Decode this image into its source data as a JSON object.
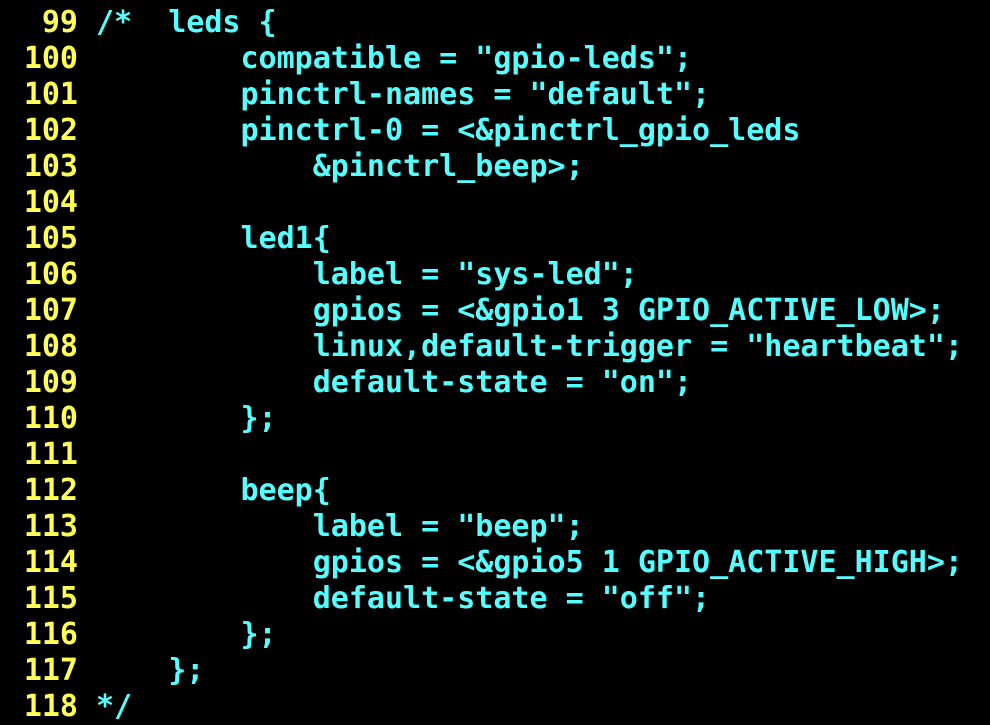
{
  "theme": {
    "background": "#000000",
    "line_number_color": "#ffff55",
    "code_color": "#55ffff"
  },
  "lines": [
    {
      "number": "99",
      "text": "/*  leds {"
    },
    {
      "number": "100",
      "text": "        compatible = \"gpio-leds\";"
    },
    {
      "number": "101",
      "text": "        pinctrl-names = \"default\";"
    },
    {
      "number": "102",
      "text": "        pinctrl-0 = <&pinctrl_gpio_leds"
    },
    {
      "number": "103",
      "text": "            &pinctrl_beep>;"
    },
    {
      "number": "104",
      "text": ""
    },
    {
      "number": "105",
      "text": "        led1{"
    },
    {
      "number": "106",
      "text": "            label = \"sys-led\";"
    },
    {
      "number": "107",
      "text": "            gpios = <&gpio1 3 GPIO_ACTIVE_LOW>;"
    },
    {
      "number": "108",
      "text": "            linux,default-trigger = \"heartbeat\";"
    },
    {
      "number": "109",
      "text": "            default-state = \"on\";"
    },
    {
      "number": "110",
      "text": "        };"
    },
    {
      "number": "111",
      "text": ""
    },
    {
      "number": "112",
      "text": "        beep{"
    },
    {
      "number": "113",
      "text": "            label = \"beep\";"
    },
    {
      "number": "114",
      "text": "            gpios = <&gpio5 1 GPIO_ACTIVE_HIGH>;"
    },
    {
      "number": "115",
      "text": "            default-state = \"off\";"
    },
    {
      "number": "116",
      "text": "        };"
    },
    {
      "number": "117",
      "text": "    };"
    },
    {
      "number": "118",
      "text": "*/"
    }
  ]
}
